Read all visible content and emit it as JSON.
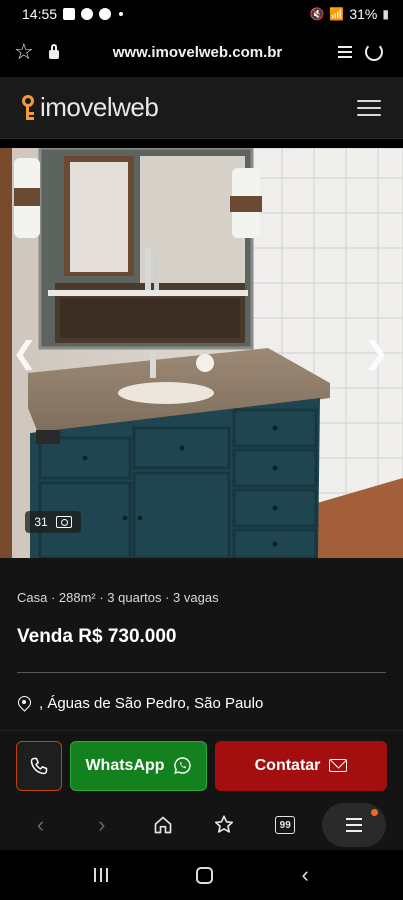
{
  "status_bar": {
    "time": "14:55",
    "battery": "31%"
  },
  "browser": {
    "url": "www.imovelweb.com.br"
  },
  "site": {
    "logo_text": "imovelweb",
    "brand_color": "#f29b38"
  },
  "gallery": {
    "photo_count": "31",
    "prev_icon": "chevron-left-icon",
    "next_icon": "chevron-right-icon"
  },
  "listing": {
    "features": "Casa · 288m² · 3 quartos · 3 vagas",
    "price": "Venda R$ 730.000",
    "location": ", Águas de São Pedro, São Paulo"
  },
  "actions": {
    "whatsapp_label": "WhatsApp",
    "contact_label": "Contatar",
    "whatsapp_color": "#14811f",
    "contact_color": "#a30f0f"
  },
  "browser_nav": {
    "tab_count": "99"
  }
}
